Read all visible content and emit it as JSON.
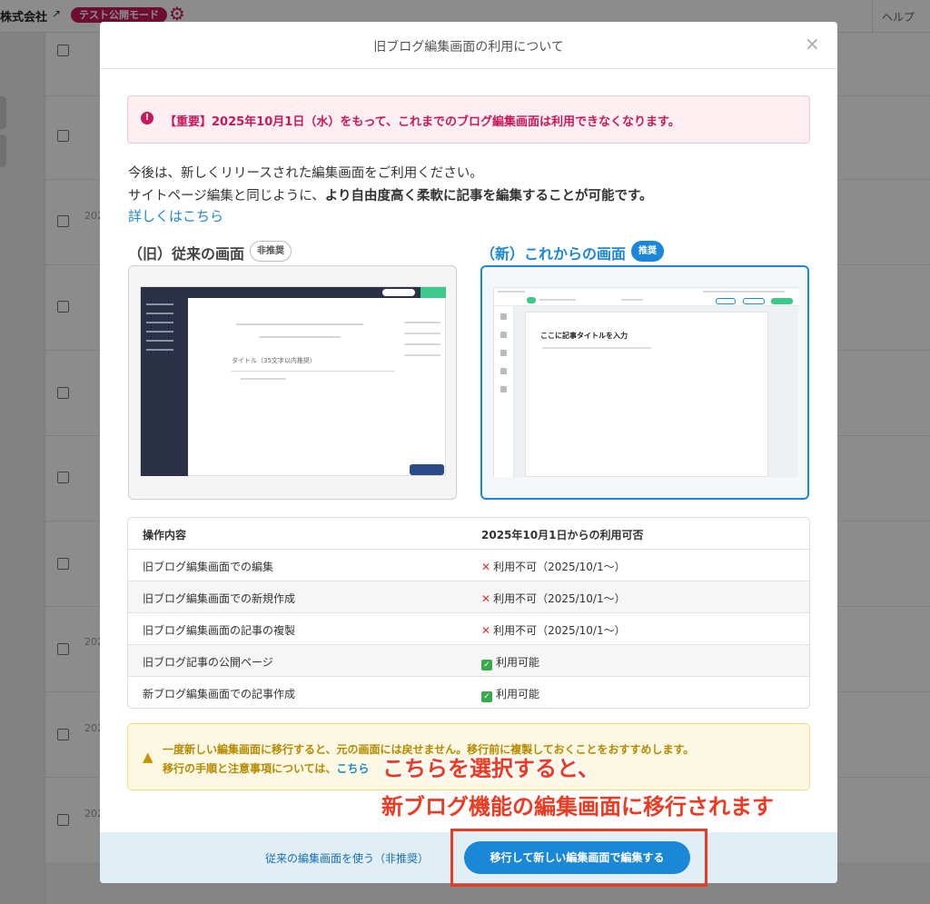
{
  "background": {
    "company": "株式会社",
    "test_badge": "テスト公開モード",
    "help": "ヘルプ",
    "dates": [
      "202",
      "202",
      "202",
      "202"
    ]
  },
  "modal": {
    "title": "旧ブログ編集画面の利用について",
    "close": "×",
    "alert_text": "【重要】2025年10月1日（水）をもって、これまでのブログ編集画面は利用できなくなります。",
    "intro_line1": "今後は、新しくリリースされた編集画面をご利用ください。",
    "intro_line2_plain": "サイトページ編集と同じように、",
    "intro_line2_bold": "より自由度高く柔軟に記事を編集することが可能です。",
    "details_link": "詳しくはこちら",
    "old": {
      "heading": "（旧）従来の画面",
      "badge": "非推奨",
      "mock_title": "タイトル（35文字以内推奨）"
    },
    "new": {
      "heading": "（新）これからの画面",
      "badge": "推奨",
      "mock_title": "ここに記事タイトルを入力"
    },
    "table": {
      "headers": [
        "操作内容",
        "2025年10月1日からの利用可否"
      ],
      "rows": [
        {
          "op": "旧ブログ編集画面での編集",
          "status": "利用不可（2025/10/1〜）",
          "ok": false
        },
        {
          "op": "旧ブログ編集画面での新規作成",
          "status": "利用不可（2025/10/1〜）",
          "ok": false
        },
        {
          "op": "旧ブログ編集画面の記事の複製",
          "status": "利用不可（2025/10/1〜）",
          "ok": false
        },
        {
          "op": "旧ブログ記事の公開ページ",
          "status": "利用可能",
          "ok": true
        },
        {
          "op": "新ブログ編集画面での記事作成",
          "status": "利用可能",
          "ok": true
        }
      ]
    },
    "warning_line1": "一度新しい編集画面に移行すると、元の画面には戻せません。移行前に複製しておくことをおすすめします。",
    "warning_line2_plain": "移行の手順と注意事項については、",
    "warning_line2_link": "こちら",
    "footer": {
      "secondary": "従来の編集画面を使う（非推奨）",
      "primary": "移行して新しい編集画面で編集する"
    }
  },
  "annotation": {
    "line1": "こちらを選択すると、",
    "line2": "新ブログ機能の編集画面に移行されます",
    "color": "#ee3a22"
  },
  "colors": {
    "brand": "#c7195a",
    "accent": "#1a87d8"
  }
}
